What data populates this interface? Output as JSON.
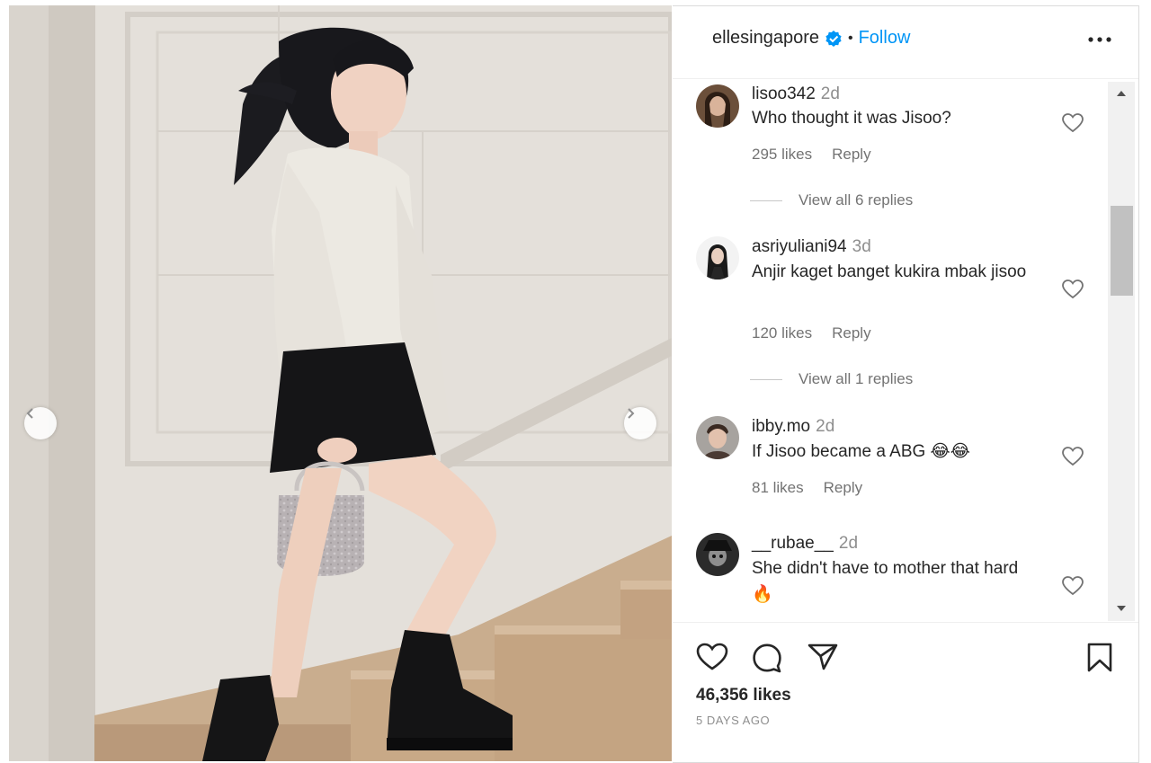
{
  "header": {
    "username": "ellesingapore",
    "separator": "•",
    "follow_label": "Follow"
  },
  "comments": [
    {
      "username": "lisoo342",
      "time": "2d",
      "text": "Who thought it was Jisoo?",
      "likes": "295 likes",
      "reply_label": "Reply",
      "view_replies": "View all 6 replies"
    },
    {
      "username": "asriyuliani94",
      "time": "3d",
      "text": "Anjir kaget banget kukira mbak jisoo",
      "likes": "120 likes",
      "reply_label": "Reply",
      "view_replies": "View all 1 replies"
    },
    {
      "username": "ibby.mo",
      "time": "2d",
      "text": "If Jisoo became a ABG 😂😂",
      "likes": "81 likes",
      "reply_label": "Reply"
    },
    {
      "username": "__rubae__",
      "time": "2d",
      "text": "She didn't have to mother that hard 🔥"
    }
  ],
  "post": {
    "likes": "46,356 likes",
    "date": "5 DAYS AGO"
  },
  "colors": {
    "accent": "#0095f6",
    "verified": "#0095f6",
    "text": "#262626",
    "secondary": "#737373"
  }
}
